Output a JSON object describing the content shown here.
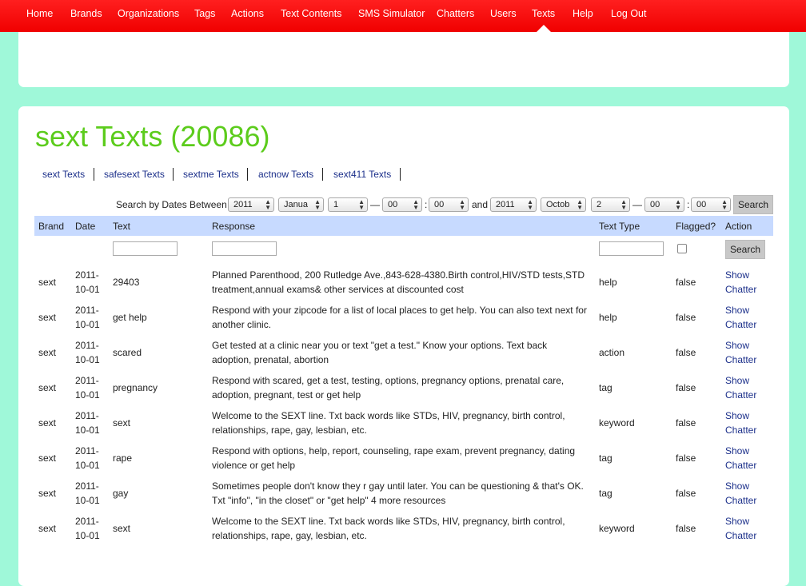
{
  "nav": {
    "items": [
      {
        "label": "Home"
      },
      {
        "label": "Brands"
      },
      {
        "label": "Organizations"
      },
      {
        "label": "Tags"
      },
      {
        "label": "Actions"
      },
      {
        "label": "Text Contents"
      },
      {
        "label": "SMS Simulator"
      },
      {
        "label": "Chatters"
      },
      {
        "label": "Users"
      },
      {
        "label": "Texts"
      },
      {
        "label": "Help"
      },
      {
        "label": "Log Out"
      }
    ],
    "active": "Texts",
    "bar_color": "#f50a0a"
  },
  "page": {
    "title": "sext Texts (20086)",
    "title_color": "#5ccc1c"
  },
  "brand_tabs": [
    {
      "label": "sext Texts"
    },
    {
      "label": "safesext Texts"
    },
    {
      "label": "sextme Texts"
    },
    {
      "label": "actnow Texts"
    },
    {
      "label": "sext411 Texts"
    }
  ],
  "date_search": {
    "label": "Search by Dates Between",
    "from": {
      "year": "2011",
      "month": "Janua",
      "day": "1",
      "hour": "00",
      "minute": "00"
    },
    "and_label": "and",
    "to": {
      "year": "2011",
      "month": "Octob",
      "day": "2",
      "hour": "00",
      "minute": "00"
    },
    "dash": "—",
    "colon": ":",
    "button": "Search"
  },
  "table": {
    "columns": [
      "Brand",
      "Date",
      "Text",
      "Response",
      "Text Type",
      "Flagged?",
      "Action"
    ],
    "header_bg": "#c7daff",
    "filter_button": "Search",
    "rows": [
      {
        "brand": "sext",
        "date": "2011-10-01",
        "text": "29403",
        "response": "Planned Parenthood, 200 Rutledge Ave.,843-628-4380.Birth control,HIV/STD tests,STD treatment,annual exams& other services at discounted cost",
        "type": "help",
        "flagged": "false",
        "show": "Show",
        "chatter": "Chatter"
      },
      {
        "brand": "sext",
        "date": "2011-10-01",
        "text": "get help",
        "response": "Respond with your zipcode for a list of local places to get help. You can also text next for another clinic.",
        "type": "help",
        "flagged": "false",
        "show": "Show",
        "chatter": "Chatter"
      },
      {
        "brand": "sext",
        "date": "2011-10-01",
        "text": "scared",
        "response": "Get tested at a clinic near you or text \"get a test.\" Know your options. Text back adoption, prenatal, abortion",
        "type": "action",
        "flagged": "false",
        "show": "Show",
        "chatter": "Chatter"
      },
      {
        "brand": "sext",
        "date": "2011-10-01",
        "text": "pregnancy",
        "response": "Respond with scared, get a test, testing, options, pregnancy options, prenatal care, adoption, pregnant, test or get help",
        "type": "tag",
        "flagged": "false",
        "show": "Show",
        "chatter": "Chatter"
      },
      {
        "brand": "sext",
        "date": "2011-10-01",
        "text": "sext",
        "response": "Welcome to the SEXT line. Txt back words like STDs, HIV, pregnancy, birth control, relationships, rape, gay, lesbian, etc.",
        "type": "keyword",
        "flagged": "false",
        "show": "Show",
        "chatter": "Chatter"
      },
      {
        "brand": "sext",
        "date": "2011-10-01",
        "text": "rape",
        "response": "Respond with options, help, report, counseling, rape exam, prevent pregnancy, dating violence or get help",
        "type": "tag",
        "flagged": "false",
        "show": "Show",
        "chatter": "Chatter"
      },
      {
        "brand": "sext",
        "date": "2011-10-01",
        "text": "gay",
        "response": "Sometimes people don't know they r gay until later. You can be questioning & that's OK. Txt \"info\", \"in the closet\" or \"get help\" 4 more resources",
        "type": "tag",
        "flagged": "false",
        "show": "Show",
        "chatter": "Chatter"
      },
      {
        "brand": "sext",
        "date": "2011-10-01",
        "text": "sext",
        "response": "Welcome to the SEXT line. Txt back words like STDs, HIV, pregnancy, birth control, relationships, rape, gay, lesbian, etc.",
        "type": "keyword",
        "flagged": "false",
        "show": "Show",
        "chatter": "Chatter"
      }
    ]
  },
  "background_color": "#9ff8d9"
}
